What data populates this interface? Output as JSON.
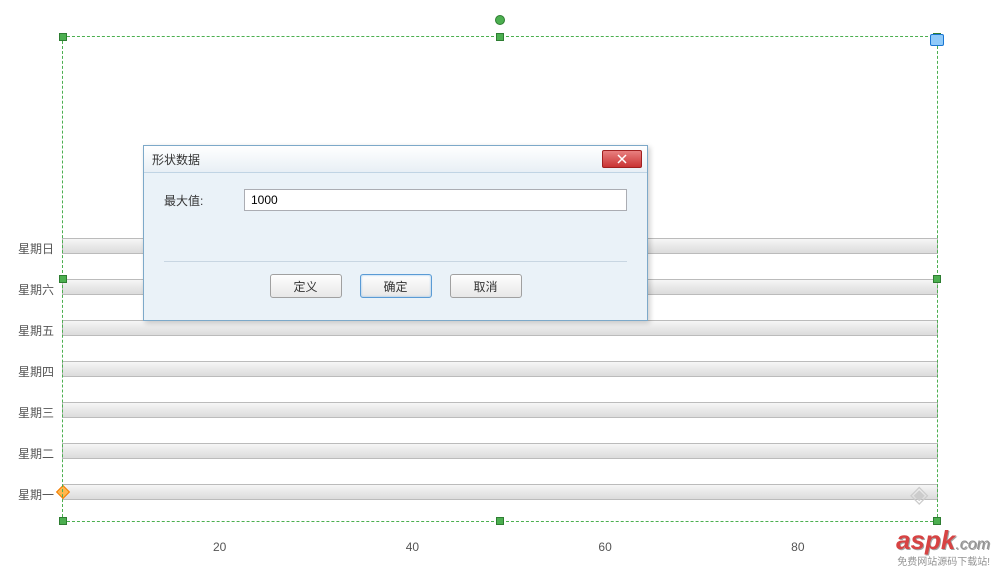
{
  "chart": {
    "selection": true,
    "y_categories": [
      "星期日",
      "星期六",
      "星期五",
      "星期四",
      "星期三",
      "星期二",
      "星期一"
    ],
    "x_ticks": [
      "20",
      "40",
      "60",
      "80"
    ]
  },
  "chart_data": {
    "type": "bar",
    "orientation": "horizontal",
    "categories": [
      "星期日",
      "星期六",
      "星期五",
      "星期四",
      "星期三",
      "星期二",
      "星期一"
    ],
    "values": [
      0,
      0,
      0,
      0,
      0,
      0,
      0
    ],
    "xlabel": "",
    "ylabel": "",
    "xlim": [
      0,
      100
    ],
    "title": ""
  },
  "dialog": {
    "title": "形状数据",
    "field_label": "最大值:",
    "field_value": "1000",
    "buttons": {
      "define": "定义",
      "ok": "确定",
      "cancel": "取消"
    }
  },
  "watermark": {
    "brand": "aspk",
    "suffix": ".com",
    "tagline": "免费网站源码下载站!"
  }
}
